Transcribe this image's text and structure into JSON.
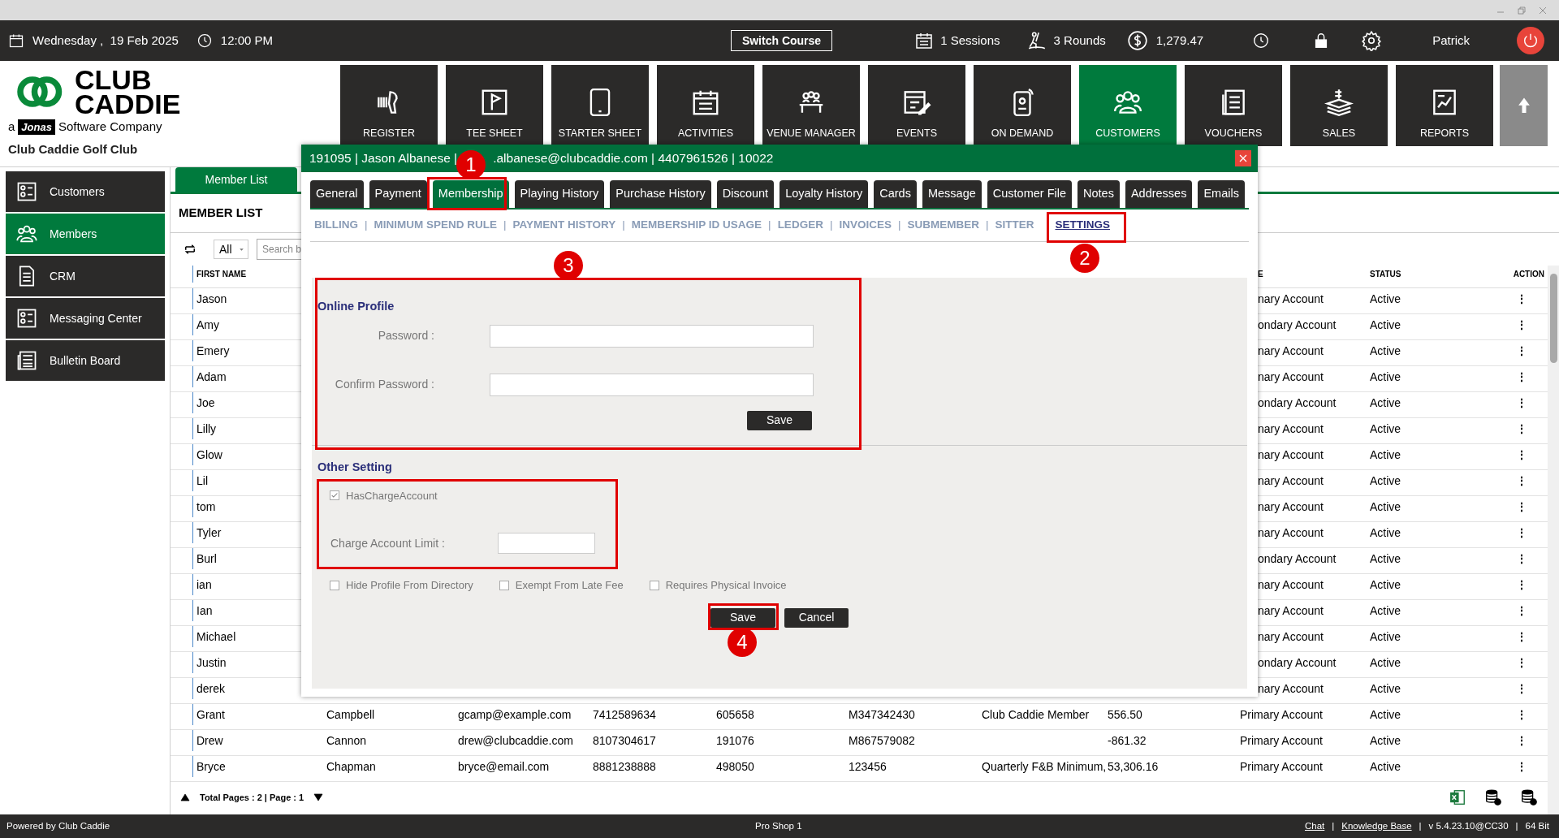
{
  "top_bar": {
    "date": "Wednesday ,  19 Feb 2025",
    "time": "12:00 PM",
    "switch_course": "Switch Course",
    "sessions": "1 Sessions",
    "rounds": "3 Rounds",
    "balance": "1,279.47",
    "user": "Patrick"
  },
  "logo": {
    "line1": "CLUB",
    "line2": "CADDIE",
    "prefix": "a",
    "brand": "Jonas",
    "suffix": "Software Company"
  },
  "club_name": "Club Caddie Golf Club",
  "nav": [
    {
      "label": "REGISTER",
      "selected": false
    },
    {
      "label": "TEE SHEET",
      "selected": false
    },
    {
      "label": "STARTER SHEET",
      "selected": false
    },
    {
      "label": "ACTIVITIES",
      "selected": false
    },
    {
      "label": "VENUE MANAGER",
      "selected": false
    },
    {
      "label": "EVENTS",
      "selected": false
    },
    {
      "label": "ON DEMAND",
      "selected": false
    },
    {
      "label": "CUSTOMERS",
      "selected": true
    },
    {
      "label": "VOUCHERS",
      "selected": false
    },
    {
      "label": "SALES",
      "selected": false
    },
    {
      "label": "REPORTS",
      "selected": false
    }
  ],
  "sidebar": [
    {
      "label": "Customers",
      "selected": false
    },
    {
      "label": "Members",
      "selected": true
    },
    {
      "label": "CRM",
      "selected": false
    },
    {
      "label": "Messaging Center",
      "selected": false
    },
    {
      "label": "Bulletin Board",
      "selected": false
    }
  ],
  "main_tabs": [
    {
      "label": "Member List",
      "selected": true
    }
  ],
  "heading": "MEMBER LIST",
  "filter": {
    "value": "All"
  },
  "search": {
    "placeholder": "Search b"
  },
  "table": {
    "columns": [
      {
        "label": "FIRST NAME"
      },
      {
        "label": "E"
      },
      {
        "label": "STATUS"
      },
      {
        "label": "ACTION"
      }
    ],
    "rows": [
      {
        "kind": "covered",
        "first_name": "Jason",
        "type": "nary Account",
        "status": "Active",
        "action": "⋮"
      },
      {
        "kind": "covered",
        "first_name": "Amy",
        "type": "ondary Account",
        "status": "Active",
        "action": "⋮"
      },
      {
        "kind": "covered",
        "first_name": "Emery",
        "type": "nary Account",
        "status": "Active",
        "action": "⋮"
      },
      {
        "kind": "covered",
        "first_name": "Adam",
        "type": "nary Account",
        "status": "Active",
        "action": "⋮"
      },
      {
        "kind": "covered",
        "first_name": "Joe",
        "type": "ondary Account",
        "status": "Active",
        "action": "⋮"
      },
      {
        "kind": "covered",
        "first_name": "Lilly",
        "type": "nary Account",
        "status": "Active",
        "action": "⋮"
      },
      {
        "kind": "covered",
        "first_name": "Glow",
        "type": "nary Account",
        "status": "Active",
        "action": "⋮"
      },
      {
        "kind": "covered",
        "first_name": "Lil",
        "type": "nary Account",
        "status": "Active",
        "action": "⋮"
      },
      {
        "kind": "covered",
        "first_name": "tom",
        "type": "nary Account",
        "status": "Active",
        "action": "⋮"
      },
      {
        "kind": "covered",
        "first_name": "Tyler",
        "type": "nary Account",
        "status": "Active",
        "action": "⋮"
      },
      {
        "kind": "covered",
        "first_name": "Burl",
        "type": "ondary Account",
        "status": "Active",
        "action": "⋮"
      },
      {
        "kind": "covered",
        "first_name": "ian",
        "type": "nary Account",
        "status": "Active",
        "action": "⋮"
      },
      {
        "kind": "covered",
        "first_name": "Ian",
        "type": "nary Account",
        "status": "Active",
        "action": "⋮"
      },
      {
        "kind": "covered",
        "first_name": "Michael",
        "type": "nary Account",
        "status": "Active",
        "action": "⋮"
      },
      {
        "kind": "covered",
        "first_name": "Justin",
        "type": "ondary Account",
        "status": "Active",
        "action": "⋮"
      },
      {
        "kind": "covered",
        "first_name": "derek",
        "type": "nary Account",
        "status": "Active",
        "action": "⋮"
      },
      {
        "kind": "full",
        "first_name": "Grant",
        "last_name": "Campbell",
        "email": "gcamp@example.com",
        "phone": "7412589634",
        "column_5": "605658",
        "column_6": "M347342430",
        "column_7": "Club Caddie Member",
        "column_8": "556.50",
        "type": "Primary Account",
        "status": "Active",
        "action": "⋮"
      },
      {
        "kind": "full",
        "first_name": "Drew",
        "last_name": "Cannon",
        "email": "drew@clubcaddie.com",
        "phone": "8107304617",
        "column_5": "191076",
        "column_6": "M867579082",
        "column_8": "-861.32",
        "type": "Primary Account",
        "status": "Active",
        "action": "⋮"
      },
      {
        "kind": "full",
        "first_name": "Bryce",
        "last_name": "Chapman",
        "email": "bryce@email.com",
        "phone": "8881238888",
        "column_5": "498050",
        "column_6": "123456",
        "column_7": "Quarterly F&B Minimum,",
        "column_8": "53,306.16",
        "type": "Primary Account",
        "status": "Active",
        "action": "⋮"
      }
    ]
  },
  "pagination": {
    "text": "Total Pages : 2 | Page : 1"
  },
  "status_bar": {
    "left": "Powered by Club Caddie",
    "center": "Pro Shop 1",
    "right": [
      {
        "kind": "link",
        "text": "Chat"
      },
      {
        "kind": "text",
        "text": "|"
      },
      {
        "kind": "link",
        "text": "Knowledge Base"
      },
      {
        "kind": "text",
        "text": "|"
      },
      {
        "kind": "text",
        "text": "v 5.4.23.10@CC30"
      },
      {
        "kind": "text",
        "text": "|"
      },
      {
        "kind": "text",
        "text": "64 Bit"
      }
    ]
  },
  "modal": {
    "title_start": "191095 | Jason Albanese |",
    "title_end": ".albanese@clubcaddie.com | 4407961526 | 10022",
    "tabs": [
      {
        "label": "General",
        "selected": false
      },
      {
        "label": "Payment",
        "selected": false
      },
      {
        "label": "Membership",
        "selected": true
      },
      {
        "label": "Playing History",
        "selected": false
      },
      {
        "label": "Purchase History",
        "selected": false
      },
      {
        "label": "Discount",
        "selected": false
      },
      {
        "label": "Loyalty History",
        "selected": false
      },
      {
        "label": "Cards",
        "selected": false
      },
      {
        "label": "Message",
        "selected": false
      },
      {
        "label": "Customer File",
        "selected": false
      },
      {
        "label": "Notes",
        "selected": false
      },
      {
        "label": "Addresses",
        "selected": false
      },
      {
        "label": "Emails",
        "selected": false
      }
    ],
    "subtabs": [
      {
        "label": "BILLING",
        "separator": "|",
        "selected": false
      },
      {
        "label": "MINIMUM SPEND RULE",
        "separator": "|",
        "selected": false
      },
      {
        "label": "PAYMENT HISTORY",
        "separator": "|",
        "selected": false
      },
      {
        "label": "MEMBERSHIP ID USAGE",
        "separator": "|",
        "selected": false
      },
      {
        "label": "LEDGER",
        "separator": "|",
        "selected": false
      },
      {
        "label": "INVOICES",
        "separator": "|",
        "selected": false
      },
      {
        "label": "SUBMEMBER",
        "separator": "|",
        "selected": false
      },
      {
        "label": "SITTER",
        "selected": false
      },
      {
        "label": "SETTINGS",
        "selected": true
      }
    ],
    "online_profile": {
      "title": "Online Profile",
      "fields": [
        {
          "label": "Password :"
        },
        {
          "label": "Confirm Password :"
        }
      ],
      "save": "Save"
    },
    "other_setting": {
      "title": "Other Setting",
      "charge": {
        "label": "HasChargeAccount",
        "checked": true
      },
      "limit_label": "Charge Account Limit :",
      "options": [
        {
          "label": "Hide Profile From Directory",
          "checked": false
        },
        {
          "label": "Exempt From Late Fee",
          "checked": false
        },
        {
          "label": "Requires Physical Invoice",
          "checked": false
        }
      ],
      "save": "Save",
      "cancel": "Cancel"
    },
    "callouts": [
      {
        "label": "1"
      },
      {
        "label": "2"
      },
      {
        "label": "3"
      },
      {
        "label": "4"
      }
    ]
  }
}
